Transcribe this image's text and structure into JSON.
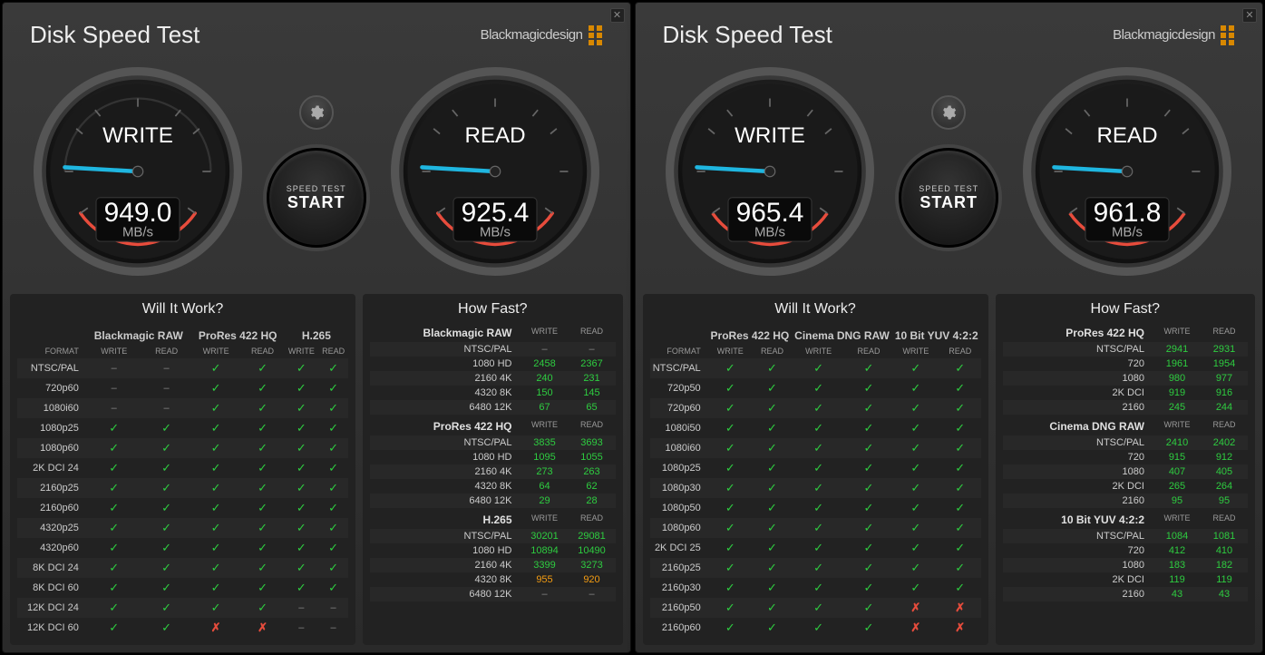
{
  "windows": [
    {
      "title": "Disk Speed Test",
      "brand": "Blackmagicdesign",
      "gauges": {
        "write": {
          "label": "WRITE",
          "value": "949.0",
          "unit": "MB/s"
        },
        "read": {
          "label": "READ",
          "value": "925.4",
          "unit": "MB/s"
        }
      },
      "start_button": {
        "line1": "SPEED TEST",
        "line2": "START"
      },
      "will_it_work": {
        "title": "Will It Work?",
        "format_header": "FORMAT",
        "col_sub": [
          "WRITE",
          "READ"
        ],
        "codecs": [
          "Blackmagic RAW",
          "ProRes 422 HQ",
          "H.265"
        ],
        "rows": [
          {
            "label": "NTSC/PAL",
            "cells": [
              "dash",
              "dash",
              "check",
              "check",
              "check",
              "check"
            ]
          },
          {
            "label": "720p60",
            "cells": [
              "dash",
              "dash",
              "check",
              "check",
              "check",
              "check"
            ]
          },
          {
            "label": "1080i60",
            "cells": [
              "dash",
              "dash",
              "check",
              "check",
              "check",
              "check"
            ]
          },
          {
            "label": "1080p25",
            "cells": [
              "check",
              "check",
              "check",
              "check",
              "check",
              "check"
            ]
          },
          {
            "label": "1080p60",
            "cells": [
              "check",
              "check",
              "check",
              "check",
              "check",
              "check"
            ]
          },
          {
            "label": "2K DCI 24",
            "cells": [
              "check",
              "check",
              "check",
              "check",
              "check",
              "check"
            ]
          },
          {
            "label": "2160p25",
            "cells": [
              "check",
              "check",
              "check",
              "check",
              "check",
              "check"
            ]
          },
          {
            "label": "2160p60",
            "cells": [
              "check",
              "check",
              "check",
              "check",
              "check",
              "check"
            ]
          },
          {
            "label": "4320p25",
            "cells": [
              "check",
              "check",
              "check",
              "check",
              "check",
              "check"
            ]
          },
          {
            "label": "4320p60",
            "cells": [
              "check",
              "check",
              "check",
              "check",
              "check",
              "check"
            ]
          },
          {
            "label": "8K DCI 24",
            "cells": [
              "check",
              "check",
              "check",
              "check",
              "check",
              "check"
            ]
          },
          {
            "label": "8K DCI 60",
            "cells": [
              "check",
              "check",
              "check",
              "check",
              "check",
              "check"
            ]
          },
          {
            "label": "12K DCI 24",
            "cells": [
              "check",
              "check",
              "check",
              "check",
              "dash",
              "dash"
            ]
          },
          {
            "label": "12K DCI 60",
            "cells": [
              "check",
              "check",
              "x",
              "x",
              "dash",
              "dash"
            ]
          }
        ]
      },
      "how_fast": {
        "title": "How Fast?",
        "col_sub": [
          "WRITE",
          "READ"
        ],
        "sections": [
          {
            "name": "Blackmagic RAW",
            "rows": [
              {
                "label": "NTSC/PAL",
                "write": "–",
                "read": "–",
                "cls": "dash"
              },
              {
                "label": "1080 HD",
                "write": "2458",
                "read": "2367"
              },
              {
                "label": "2160 4K",
                "write": "240",
                "read": "231"
              },
              {
                "label": "4320 8K",
                "write": "150",
                "read": "145"
              },
              {
                "label": "6480 12K",
                "write": "67",
                "read": "65"
              }
            ]
          },
          {
            "name": "ProRes 422 HQ",
            "rows": [
              {
                "label": "NTSC/PAL",
                "write": "3835",
                "read": "3693"
              },
              {
                "label": "1080 HD",
                "write": "1095",
                "read": "1055"
              },
              {
                "label": "2160 4K",
                "write": "273",
                "read": "263"
              },
              {
                "label": "4320 8K",
                "write": "64",
                "read": "62"
              },
              {
                "label": "6480 12K",
                "write": "29",
                "read": "28"
              }
            ]
          },
          {
            "name": "H.265",
            "rows": [
              {
                "label": "NTSC/PAL",
                "write": "30201",
                "read": "29081"
              },
              {
                "label": "1080 HD",
                "write": "10894",
                "read": "10490"
              },
              {
                "label": "2160 4K",
                "write": "3399",
                "read": "3273"
              },
              {
                "label": "4320 8K",
                "write": "955",
                "read": "920",
                "cls": "amber"
              },
              {
                "label": "6480 12K",
                "write": "–",
                "read": "–",
                "cls": "dash"
              }
            ]
          }
        ]
      }
    },
    {
      "title": "Disk Speed Test",
      "brand": "Blackmagicdesign",
      "gauges": {
        "write": {
          "label": "WRITE",
          "value": "965.4",
          "unit": "MB/s"
        },
        "read": {
          "label": "READ",
          "value": "961.8",
          "unit": "MB/s"
        }
      },
      "start_button": {
        "line1": "SPEED TEST",
        "line2": "START"
      },
      "will_it_work": {
        "title": "Will It Work?",
        "format_header": "FORMAT",
        "col_sub": [
          "WRITE",
          "READ"
        ],
        "codecs": [
          "ProRes 422 HQ",
          "Cinema DNG RAW",
          "10 Bit YUV 4:2:2"
        ],
        "rows": [
          {
            "label": "NTSC/PAL",
            "cells": [
              "check",
              "check",
              "check",
              "check",
              "check",
              "check"
            ]
          },
          {
            "label": "720p50",
            "cells": [
              "check",
              "check",
              "check",
              "check",
              "check",
              "check"
            ]
          },
          {
            "label": "720p60",
            "cells": [
              "check",
              "check",
              "check",
              "check",
              "check",
              "check"
            ]
          },
          {
            "label": "1080i50",
            "cells": [
              "check",
              "check",
              "check",
              "check",
              "check",
              "check"
            ]
          },
          {
            "label": "1080i60",
            "cells": [
              "check",
              "check",
              "check",
              "check",
              "check",
              "check"
            ]
          },
          {
            "label": "1080p25",
            "cells": [
              "check",
              "check",
              "check",
              "check",
              "check",
              "check"
            ]
          },
          {
            "label": "1080p30",
            "cells": [
              "check",
              "check",
              "check",
              "check",
              "check",
              "check"
            ]
          },
          {
            "label": "1080p50",
            "cells": [
              "check",
              "check",
              "check",
              "check",
              "check",
              "check"
            ]
          },
          {
            "label": "1080p60",
            "cells": [
              "check",
              "check",
              "check",
              "check",
              "check",
              "check"
            ]
          },
          {
            "label": "2K DCI 25",
            "cells": [
              "check",
              "check",
              "check",
              "check",
              "check",
              "check"
            ]
          },
          {
            "label": "2160p25",
            "cells": [
              "check",
              "check",
              "check",
              "check",
              "check",
              "check"
            ]
          },
          {
            "label": "2160p30",
            "cells": [
              "check",
              "check",
              "check",
              "check",
              "check",
              "check"
            ]
          },
          {
            "label": "2160p50",
            "cells": [
              "check",
              "check",
              "check",
              "check",
              "x",
              "x"
            ]
          },
          {
            "label": "2160p60",
            "cells": [
              "check",
              "check",
              "check",
              "check",
              "x",
              "x"
            ]
          }
        ]
      },
      "how_fast": {
        "title": "How Fast?",
        "col_sub": [
          "WRITE",
          "READ"
        ],
        "sections": [
          {
            "name": "ProRes 422 HQ",
            "rows": [
              {
                "label": "NTSC/PAL",
                "write": "2941",
                "read": "2931"
              },
              {
                "label": "720",
                "write": "1961",
                "read": "1954"
              },
              {
                "label": "1080",
                "write": "980",
                "read": "977"
              },
              {
                "label": "2K DCI",
                "write": "919",
                "read": "916"
              },
              {
                "label": "2160",
                "write": "245",
                "read": "244"
              }
            ]
          },
          {
            "name": "Cinema DNG RAW",
            "rows": [
              {
                "label": "NTSC/PAL",
                "write": "2410",
                "read": "2402"
              },
              {
                "label": "720",
                "write": "915",
                "read": "912"
              },
              {
                "label": "1080",
                "write": "407",
                "read": "405"
              },
              {
                "label": "2K DCI",
                "write": "265",
                "read": "264"
              },
              {
                "label": "2160",
                "write": "95",
                "read": "95"
              }
            ]
          },
          {
            "name": "10 Bit YUV 4:2:2",
            "rows": [
              {
                "label": "NTSC/PAL",
                "write": "1084",
                "read": "1081"
              },
              {
                "label": "720",
                "write": "412",
                "read": "410"
              },
              {
                "label": "1080",
                "write": "183",
                "read": "182"
              },
              {
                "label": "2K DCI",
                "write": "119",
                "read": "119"
              },
              {
                "label": "2160",
                "write": "43",
                "read": "43"
              }
            ]
          }
        ]
      }
    }
  ]
}
